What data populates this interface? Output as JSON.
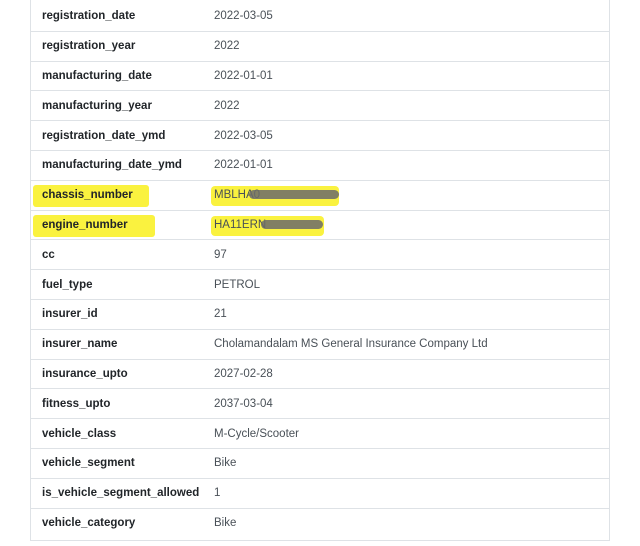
{
  "rows": [
    {
      "key": "registration_date",
      "value": "2022-03-05"
    },
    {
      "key": "registration_year",
      "value": "2022"
    },
    {
      "key": "manufacturing_date",
      "value": "2022-01-01"
    },
    {
      "key": "manufacturing_year",
      "value": "2022"
    },
    {
      "key": "registration_date_ymd",
      "value": "2022-03-05"
    },
    {
      "key": "manufacturing_date_ymd",
      "value": "2022-01-01"
    },
    {
      "key": "chassis_number",
      "value": "MBLHA0",
      "highlighted": true,
      "redacted": true
    },
    {
      "key": "engine_number",
      "value": "HA11ERN",
      "highlighted": true,
      "redacted": true
    },
    {
      "key": "cc",
      "value": "97"
    },
    {
      "key": "fuel_type",
      "value": "PETROL"
    },
    {
      "key": "insurer_id",
      "value": "21"
    },
    {
      "key": "insurer_name",
      "value": "Cholamandalam MS General Insurance Company Ltd"
    },
    {
      "key": "insurance_upto",
      "value": "2027-02-28"
    },
    {
      "key": "fitness_upto",
      "value": "2037-03-04"
    },
    {
      "key": "vehicle_class",
      "value": "M-Cycle/Scooter"
    },
    {
      "key": "vehicle_segment",
      "value": "Bike"
    },
    {
      "key": "is_vehicle_segment_allowed",
      "value": "1"
    },
    {
      "key": "vehicle_category",
      "value": "Bike"
    }
  ],
  "colors": {
    "highlight": "#f9f12a",
    "border": "#dee2e6",
    "key_text": "#212529",
    "value_text": "#495057"
  }
}
